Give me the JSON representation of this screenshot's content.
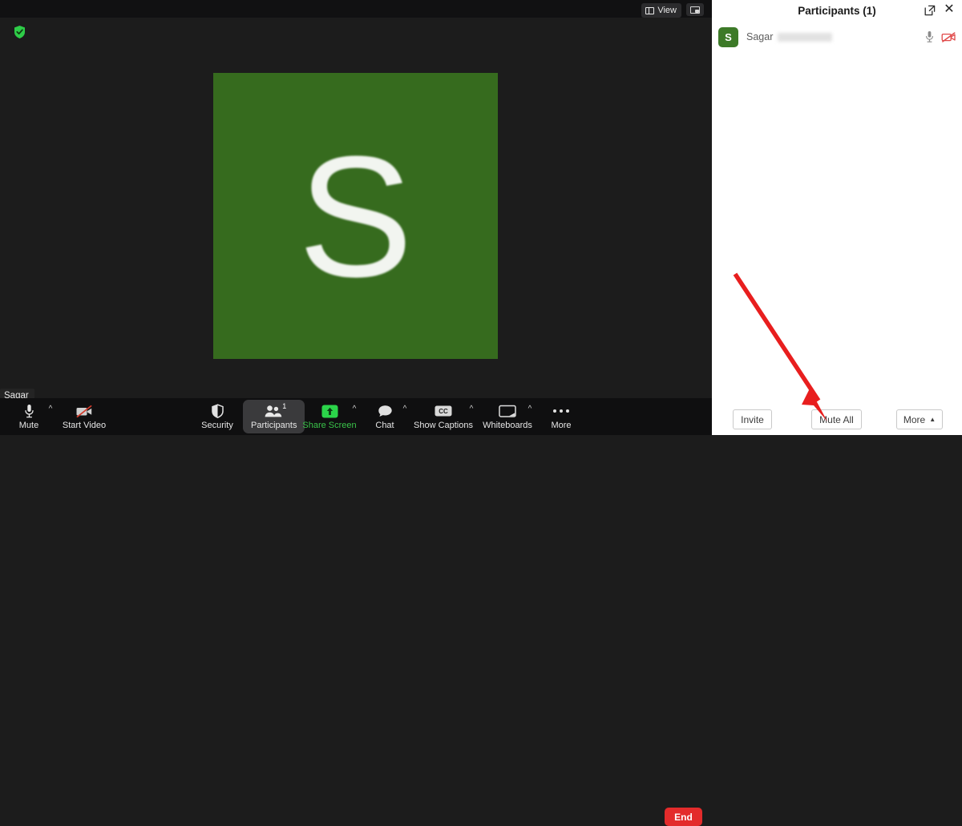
{
  "meeting": {
    "topbar": {
      "view_label": "View",
      "view_icon": "grid-view-icon",
      "pip_icon": "picture-in-picture-icon"
    },
    "encryption_icon": "green-shield-check-icon",
    "speaker": {
      "initial": "S",
      "name_label": "Sagar",
      "avatar_color": "#366b1e"
    }
  },
  "toolbar": {
    "items": [
      {
        "label": "Mute",
        "icon": "microphone-icon",
        "has_caret": true
      },
      {
        "label": "Start Video",
        "icon": "camera-off-icon",
        "has_caret": false
      },
      {
        "label": "Security",
        "icon": "shield-icon",
        "has_caret": false
      },
      {
        "label": "Participants",
        "icon": "participants-icon",
        "badge": "1",
        "has_caret": true,
        "active": true
      },
      {
        "label": "Share Screen",
        "icon": "share-screen-icon",
        "has_caret": true,
        "accent": "#3ac34a"
      },
      {
        "label": "Chat",
        "icon": "chat-bubble-icon",
        "has_caret": true
      },
      {
        "label": "Show Captions",
        "icon": "closed-caption-icon",
        "has_caret": true
      },
      {
        "label": "Whiteboards",
        "icon": "whiteboard-icon",
        "has_caret": true
      },
      {
        "label": "More",
        "icon": "ellipsis-icon",
        "has_caret": false
      }
    ],
    "end_label": "End",
    "end_color": "#e32b2b"
  },
  "panel": {
    "title": "Participants (1)",
    "popout_icon": "popout-icon",
    "close_icon": "close-icon",
    "participant": {
      "initial": "S",
      "name": "Sagar",
      "name_redacted": true,
      "mic_icon": "microphone-icon",
      "video_icon": "video-off-icon",
      "video_icon_color": "#e04848"
    },
    "footer": {
      "invite_label": "Invite",
      "mute_all_label": "Mute All",
      "more_label": "More",
      "more_caret": "▲"
    }
  },
  "annotation": {
    "arrow_color": "#e81e1e",
    "points_at": "Mute All"
  }
}
